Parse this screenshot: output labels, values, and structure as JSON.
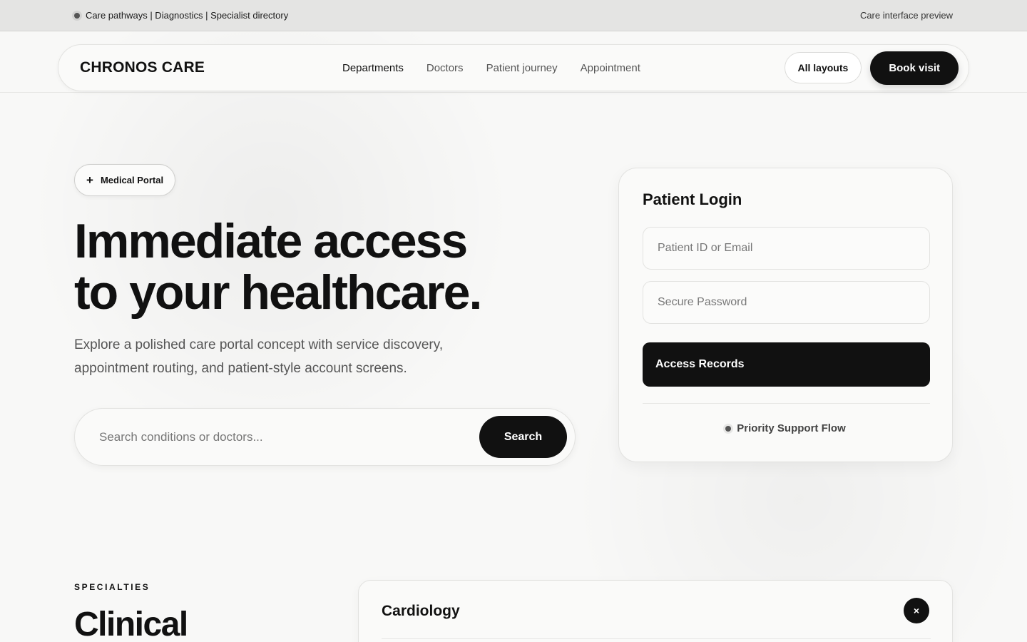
{
  "topbar": {
    "links_text": "Care pathways | Diagnostics | Specialist directory",
    "right_text": "Care interface preview"
  },
  "nav": {
    "logo": "CHRONOS CARE",
    "links": [
      {
        "label": "Departments",
        "active": true
      },
      {
        "label": "Doctors",
        "active": false
      },
      {
        "label": "Patient journey",
        "active": false
      },
      {
        "label": "Appointment",
        "active": false
      }
    ],
    "all_layouts_label": "All layouts",
    "book_visit_label": "Book visit"
  },
  "hero": {
    "pill_icon": "+",
    "pill_label": "Medical Portal",
    "title_line1": "Immediate access",
    "title_line2": "to your healthcare.",
    "subtitle": "Explore a polished care portal concept with service discovery, appointment routing, and patient-style account screens.",
    "search_placeholder": "Search conditions or doctors...",
    "search_button": "Search"
  },
  "login": {
    "title": "Patient Login",
    "id_placeholder": "Patient ID or Email",
    "password_placeholder": "Secure Password",
    "submit_label": "Access Records",
    "support_text": "Priority Support Flow"
  },
  "specialties": {
    "eyebrow": "SPECIALTIES",
    "title": "Clinical",
    "card_title": "Cardiology",
    "close_icon": "×"
  }
}
